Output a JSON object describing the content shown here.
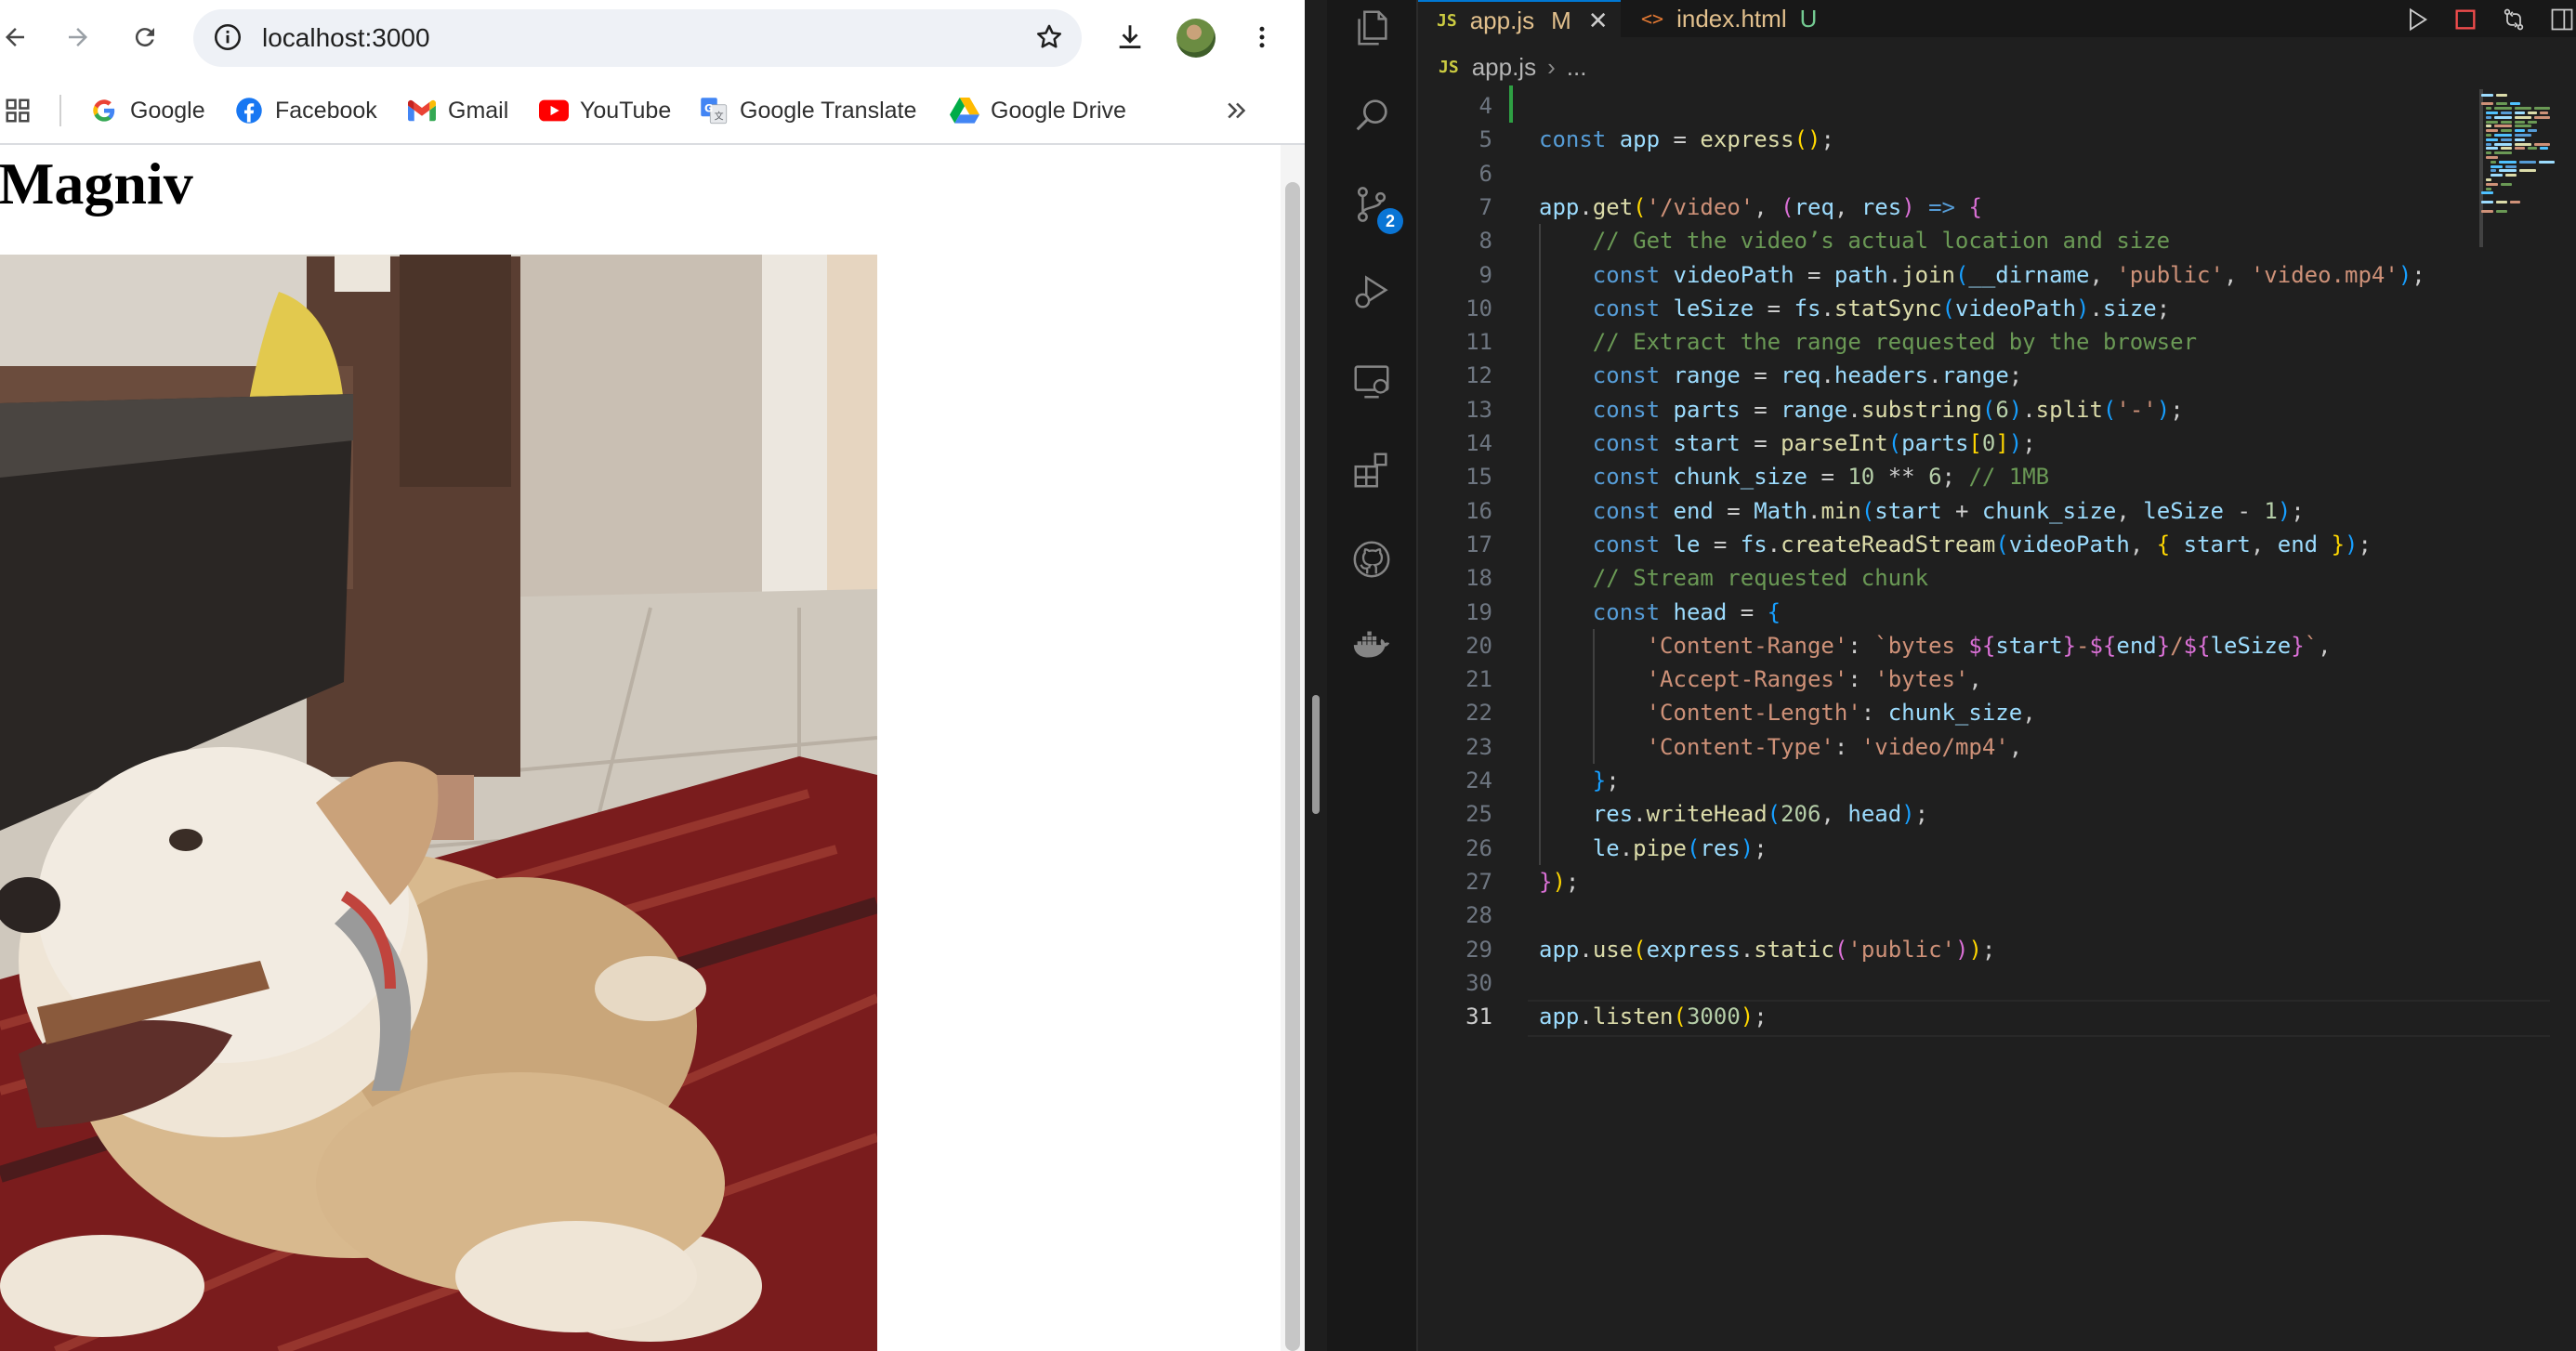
{
  "browser": {
    "url": "localhost:3000",
    "bookmarks": [
      {
        "label": "Google",
        "icon": "google-icon"
      },
      {
        "label": "Facebook",
        "icon": "facebook-icon"
      },
      {
        "label": "Gmail",
        "icon": "gmail-icon"
      },
      {
        "label": "YouTube",
        "icon": "youtube-icon"
      },
      {
        "label": "Google Translate",
        "icon": "google-translate-icon"
      },
      {
        "label": "Google Drive",
        "icon": "google-drive-icon"
      }
    ],
    "page": {
      "heading": "Magniv",
      "video_description": "Video frame: a tan and white dog lying on a red patterned rug chewing a stick"
    }
  },
  "vscode": {
    "tabs": [
      {
        "icon": "JS",
        "label": "app.js",
        "status": "M",
        "active": true
      },
      {
        "icon": "<>",
        "label": "index.html",
        "status": "U",
        "active": false
      }
    ],
    "breadcrumb": {
      "icon": "JS",
      "file": "app.js",
      "rest": "..."
    },
    "scm_badge": "2",
    "current_line": "31",
    "lines": [
      {
        "n": "4",
        "code": ""
      },
      {
        "n": "5",
        "code": "const app = express();"
      },
      {
        "n": "6",
        "code": ""
      },
      {
        "n": "7",
        "code": "app.get('/video', (req, res) => {"
      },
      {
        "n": "8",
        "code": "    // Get the video’s actual location and size"
      },
      {
        "n": "9",
        "code": "    const videoPath = path.join(__dirname, 'public', 'video.mp4');"
      },
      {
        "n": "10",
        "code": "    const leSize = fs.statSync(videoPath).size;"
      },
      {
        "n": "11",
        "code": "    // Extract the range requested by the browser"
      },
      {
        "n": "12",
        "code": "    const range = req.headers.range;"
      },
      {
        "n": "13",
        "code": "    const parts = range.substring(6).split('-');"
      },
      {
        "n": "14",
        "code": "    const start = parseInt(parts[0]);"
      },
      {
        "n": "15",
        "code": "    const chunk_size = 10 ** 6; // 1MB"
      },
      {
        "n": "16",
        "code": "    const end = Math.min(start + chunk_size, leSize - 1);"
      },
      {
        "n": "17",
        "code": "    const le = fs.createReadStream(videoPath, { start, end });"
      },
      {
        "n": "18",
        "code": "    // Stream requested chunk"
      },
      {
        "n": "19",
        "code": "    const head = {"
      },
      {
        "n": "20",
        "code": "        'Content-Range': `bytes ${start}-${end}/${leSize}`,"
      },
      {
        "n": "21",
        "code": "        'Accept-Ranges': 'bytes',"
      },
      {
        "n": "22",
        "code": "        'Content-Length': chunk_size,"
      },
      {
        "n": "23",
        "code": "        'Content-Type': 'video/mp4',"
      },
      {
        "n": "24",
        "code": "    };"
      },
      {
        "n": "25",
        "code": "    res.writeHead(206, head);"
      },
      {
        "n": "26",
        "code": "    le.pipe(res);"
      },
      {
        "n": "27",
        "code": "});"
      },
      {
        "n": "28",
        "code": ""
      },
      {
        "n": "29",
        "code": "app.use(express.static('public'));"
      },
      {
        "n": "30",
        "code": ""
      },
      {
        "n": "31",
        "code": "app.listen(3000);"
      }
    ]
  }
}
